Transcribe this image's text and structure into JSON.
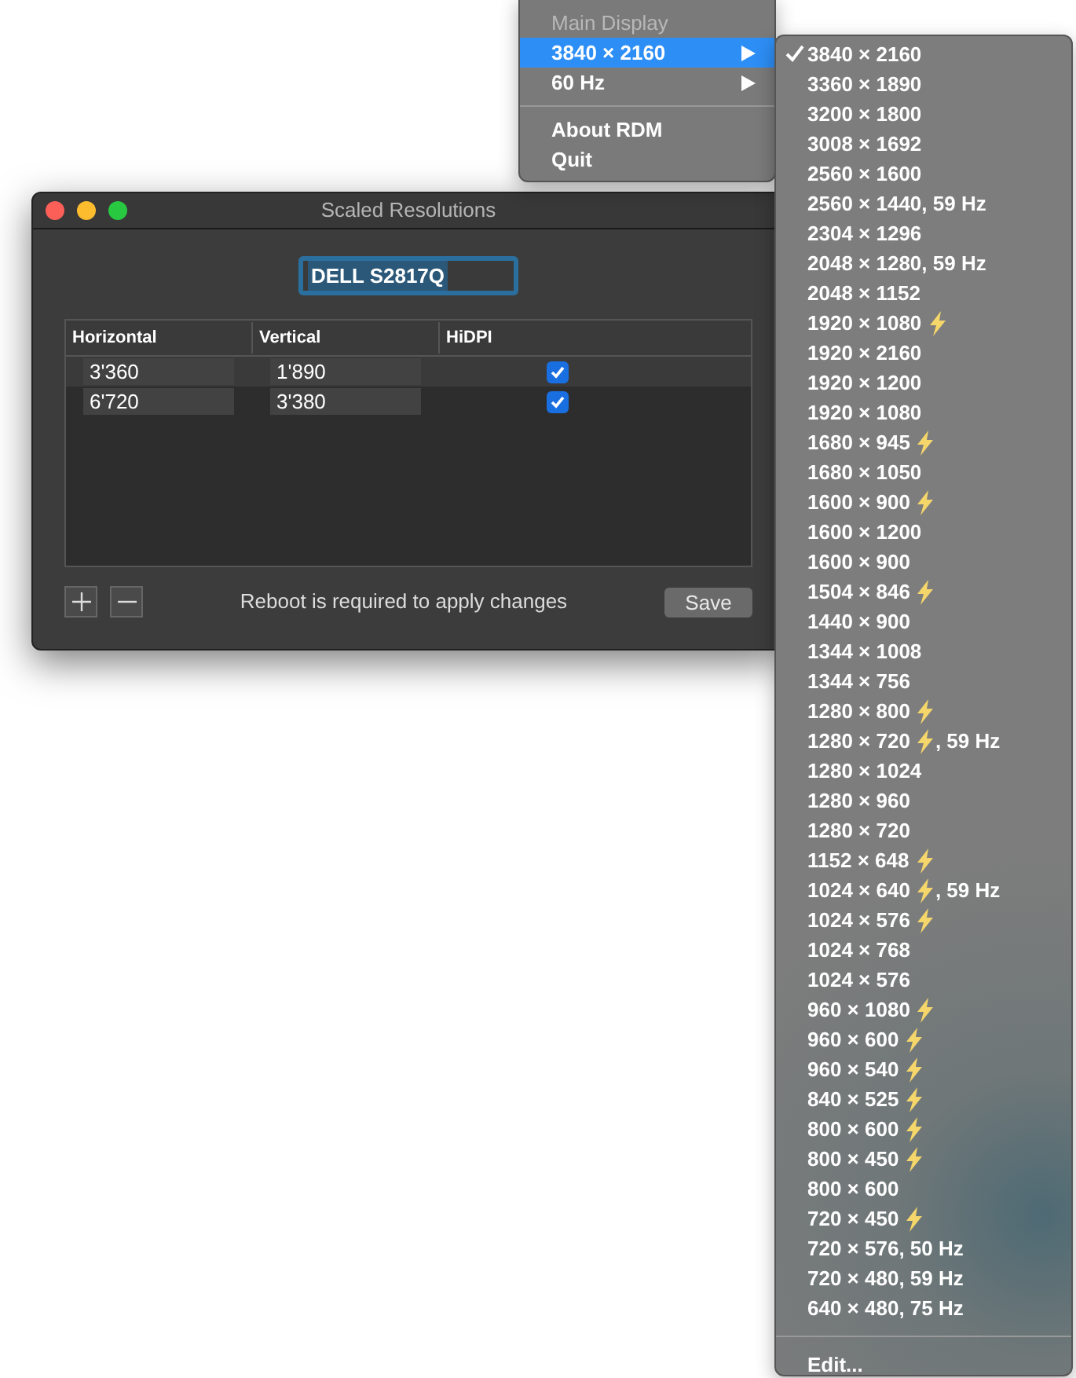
{
  "main_menu": {
    "sections": [
      [
        {
          "label": "Main Display",
          "disabled": true,
          "selected": false,
          "submenu": false
        },
        {
          "label": "3840 × 2160",
          "disabled": false,
          "selected": true,
          "submenu": true
        },
        {
          "label": "60 Hz",
          "disabled": false,
          "selected": false,
          "submenu": true
        }
      ],
      [
        {
          "label": "About RDM",
          "disabled": false,
          "selected": false,
          "submenu": false
        },
        {
          "label": "Quit",
          "disabled": false,
          "selected": false,
          "submenu": false
        }
      ]
    ]
  },
  "resolution_menu": {
    "items": [
      {
        "label": "3840 × 2160",
        "checked": true,
        "fast": false
      },
      {
        "label": "3360 × 1890",
        "checked": false,
        "fast": false
      },
      {
        "label": "3200 × 1800",
        "checked": false,
        "fast": false
      },
      {
        "label": "3008 × 1692",
        "checked": false,
        "fast": false
      },
      {
        "label": "2560 × 1600",
        "checked": false,
        "fast": false
      },
      {
        "label": "2560 × 1440, 59 Hz",
        "checked": false,
        "fast": false
      },
      {
        "label": "2304 × 1296",
        "checked": false,
        "fast": false
      },
      {
        "label": "2048 × 1280, 59 Hz",
        "checked": false,
        "fast": false
      },
      {
        "label": "2048 × 1152",
        "checked": false,
        "fast": false
      },
      {
        "label": "1920 × 1080",
        "checked": false,
        "fast": true
      },
      {
        "label": "1920 × 2160",
        "checked": false,
        "fast": false
      },
      {
        "label": "1920 × 1200",
        "checked": false,
        "fast": false
      },
      {
        "label": "1920 × 1080",
        "checked": false,
        "fast": false
      },
      {
        "label": "1680 × 945",
        "checked": false,
        "fast": true
      },
      {
        "label": "1680 × 1050",
        "checked": false,
        "fast": false
      },
      {
        "label": "1600 × 900",
        "checked": false,
        "fast": true
      },
      {
        "label": "1600 × 1200",
        "checked": false,
        "fast": false
      },
      {
        "label": "1600 × 900",
        "checked": false,
        "fast": false
      },
      {
        "label": "1504 × 846",
        "checked": false,
        "fast": true
      },
      {
        "label": "1440 × 900",
        "checked": false,
        "fast": false
      },
      {
        "label": "1344 × 1008",
        "checked": false,
        "fast": false
      },
      {
        "label": "1344 × 756",
        "checked": false,
        "fast": false
      },
      {
        "label": "1280 × 800",
        "checked": false,
        "fast": true
      },
      {
        "label": "1280 × 720",
        "checked": false,
        "fast": true,
        "rate": ", 59 Hz"
      },
      {
        "label": "1280 × 1024",
        "checked": false,
        "fast": false
      },
      {
        "label": "1280 × 960",
        "checked": false,
        "fast": false
      },
      {
        "label": "1280 × 720",
        "checked": false,
        "fast": false
      },
      {
        "label": "1152 × 648",
        "checked": false,
        "fast": true
      },
      {
        "label": "1024 × 640",
        "checked": false,
        "fast": true,
        "rate": ", 59 Hz"
      },
      {
        "label": "1024 × 576",
        "checked": false,
        "fast": true
      },
      {
        "label": "1024 × 768",
        "checked": false,
        "fast": false
      },
      {
        "label": "1024 × 576",
        "checked": false,
        "fast": false
      },
      {
        "label": "960 × 1080",
        "checked": false,
        "fast": true
      },
      {
        "label": "960 × 600",
        "checked": false,
        "fast": true
      },
      {
        "label": "960 × 540",
        "checked": false,
        "fast": true
      },
      {
        "label": "840 × 525",
        "checked": false,
        "fast": true
      },
      {
        "label": "800 × 600",
        "checked": false,
        "fast": true
      },
      {
        "label": "800 × 450",
        "checked": false,
        "fast": true
      },
      {
        "label": "800 × 600",
        "checked": false,
        "fast": false
      },
      {
        "label": "720 × 450",
        "checked": false,
        "fast": true
      },
      {
        "label": "720 × 576, 50 Hz",
        "checked": false,
        "fast": false
      },
      {
        "label": "720 × 480, 59 Hz",
        "checked": false,
        "fast": false
      },
      {
        "label": "640 × 480, 75 Hz",
        "checked": false,
        "fast": false
      }
    ],
    "footer": "Edit..."
  },
  "window": {
    "title": "Scaled Resolutions",
    "display_name": "DELL S2817Q",
    "table": {
      "columns": [
        "Horizontal",
        "Vertical",
        "HiDPI"
      ],
      "rows": [
        {
          "horizontal": "3'360",
          "vertical": "1'890",
          "hidpi": true
        },
        {
          "horizontal": "6'720",
          "vertical": "3'380",
          "hidpi": true
        }
      ]
    },
    "status": "Reboot is required to apply changes",
    "save_button": "Save"
  }
}
